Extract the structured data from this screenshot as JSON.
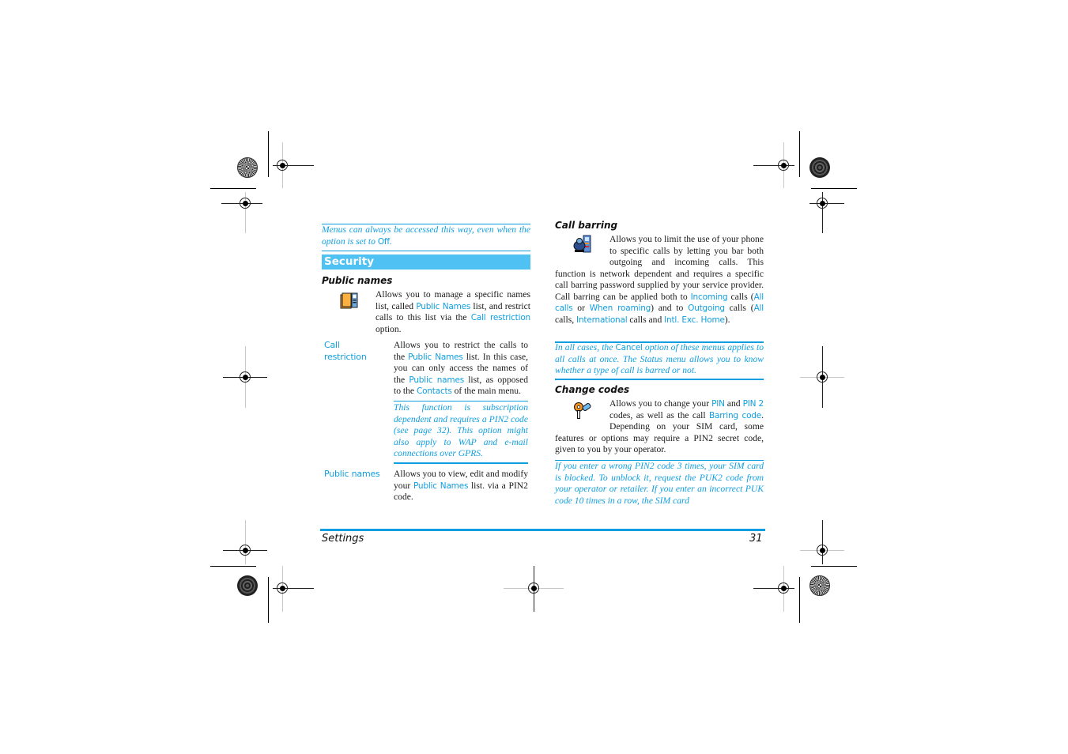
{
  "intro_note": {
    "text_before": "Menus can always be accessed this way, even when the option is set to ",
    "link": "Off",
    "text_after": "."
  },
  "section": {
    "title": "Security"
  },
  "public_names": {
    "heading": "Public names",
    "icon": "phonebook-icon",
    "p1": "Allows you to manage a specific names list, called ",
    "link1": "Public Names",
    "p2": " list, and restrict calls to this list via the ",
    "link2": "Call restriction",
    "p3": " option."
  },
  "call_restriction": {
    "label_line1": "Call",
    "label_line2": "restriction",
    "t1": "Allows you to restrict the calls to the ",
    "l1": "Public Names",
    "t2": " list. In this case, you can only access the names of the ",
    "l2": "Public names",
    "t3": " list, as opposed to the ",
    "l3": "Contacts",
    "t4": " of the main menu.",
    "note": "This function is subscription dependent and requires a PIN2 code (see page 32). This option might also apply to WAP and e-mail connections over GPRS."
  },
  "public_names_item": {
    "label": "Public names",
    "t1": "Allows you to view, edit and modify your ",
    "l1": "Public Names",
    "t2": " list. via a PIN2 code."
  },
  "call_barring": {
    "heading": "Call barring",
    "icon": "call-barring-icon",
    "t1": "Allows you to limit the use of your phone to specific calls by letting you bar both outgoing and incoming calls. This function is network dependent and requires a specific call barring password supplied by your service provider. Call barring can be applied both to ",
    "l_incoming": "Incoming",
    "t2": " calls (",
    "l_all_calls": "All calls",
    "t3": " or ",
    "l_roaming": "When roaming",
    "t4": ") and to ",
    "l_outgoing": "Outgoing",
    "t5": " calls (",
    "l_all": "All",
    "t6": " calls, ",
    "l_international": "International",
    "t7": " calls and ",
    "l_intl_exc": "Intl. Exc. Home",
    "t8": ").",
    "note_before": "In all cases, the ",
    "note_link": "Cancel",
    "note_after": " option of these menus applies to all calls at once. The Status menu allows you to know whether a type of call is barred or not."
  },
  "change_codes": {
    "heading": "Change codes",
    "icon": "key-icon",
    "t1": "Allows you to change your ",
    "l_pin": "PIN",
    "t2": " and ",
    "l_pin2": "PIN 2",
    "t3": " codes, as well as the call ",
    "l_barring": "Barring code",
    "t4": ". Depending on your SIM card, some features or options may require a PIN2 secret code, given to you by your operator.",
    "note": "If you enter a wrong PIN2 code 3 times, your SIM card is blocked. To unblock it, request the PUK2 code from your operator or retailer. If you enter an incorrect PUK code 10 times in a row, the SIM card"
  },
  "footer": {
    "chapter": "Settings",
    "page_number": "31"
  },
  "colors": {
    "accent": "#0f9ee0",
    "section_bar": "#4fc1f3"
  }
}
